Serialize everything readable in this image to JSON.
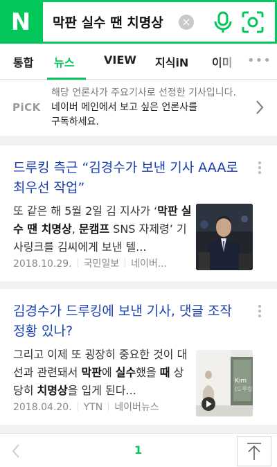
{
  "header": {
    "logo": "N",
    "query": "막판 실수 땐 치명상",
    "clear_icon": "close-icon",
    "voice_icon": "microphone-icon",
    "lens_icon": "camera-lens-icon",
    "brand_color": "#03c75a"
  },
  "tabs": [
    {
      "label": "통합"
    },
    {
      "label": "뉴스",
      "active": true
    },
    {
      "label": "VIEW"
    },
    {
      "label": "지식iN"
    },
    {
      "label": "이미"
    }
  ],
  "pick": {
    "label": "PiCK",
    "line1": "해당 언론사가 주요기사로 선정한 기사입니다.",
    "line2": "네이버 메인에서 보고 싶은 언론사를",
    "line3": "구독하세요."
  },
  "articles": [
    {
      "title_1": "드루킹 측근 “김경수가 보낸 기사 AAA로",
      "title_2": "최우선 작업”",
      "body": [
        {
          "t": "또 같은 해 5월 2일 김 지사가 ‘",
          "b": false
        },
        {
          "t": "막판",
          "b": true
        },
        {
          "t": " ",
          "b": false
        },
        {
          "t": "실수 땐 치명상",
          "b": true
        },
        {
          "t": ", ",
          "b": false
        },
        {
          "t": "문캠프",
          "b": true
        },
        {
          "t": " SNS 자제령’ 기사링크를 김씨에게 보낸 텔...",
          "b": false
        }
      ],
      "date": "2018.10.29.",
      "press": "국민일보",
      "source": "네이버..."
    },
    {
      "title_1": "김경수가 드루킹에 보낸 기사, 댓글 조작",
      "title_2": "정황 있나?",
      "body": [
        {
          "t": "그리고 이제 또 굉장히 중요한 것이 대선과 관련돼서 ",
          "b": false
        },
        {
          "t": "막판",
          "b": true
        },
        {
          "t": "에 ",
          "b": false
        },
        {
          "t": "실수",
          "b": true
        },
        {
          "t": "했을 ",
          "b": false
        },
        {
          "t": "때",
          "b": true
        },
        {
          "t": " 상당히 ",
          "b": false
        },
        {
          "t": "치명상",
          "b": true
        },
        {
          "t": "을 입게 된다...",
          "b": false
        }
      ],
      "date": "2018.04.20.",
      "press": "YTN",
      "source": "네이버뉴스",
      "thumb_caption": "Kim",
      "thumb_caption2": "(드루킹)"
    }
  ],
  "pager": {
    "current_page": "1"
  }
}
